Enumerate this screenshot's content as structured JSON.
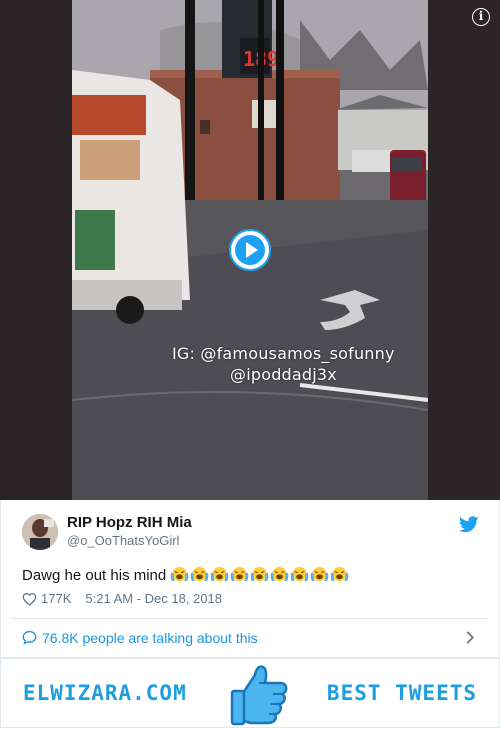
{
  "video": {
    "watermark_line1": "IG: @famousamos_sofunny",
    "watermark_line2": "@ipoddadj3x",
    "price_sign": "189",
    "info_icon": "info-icon",
    "play_icon": "play-icon"
  },
  "tweet": {
    "display_name": "RIP Hopz RIH Mia",
    "handle": "@o_OoThatsYoGirl",
    "text": "Dawg he out his mind",
    "emoji_name": "loudly-crying-face-icon",
    "emoji_count": 9,
    "likes": "177K",
    "timestamp": "5:21 AM - Dec 18, 2018",
    "talking": "76.8K people are talking about this"
  },
  "banner": {
    "left": "ELWIZARA.COM",
    "right": "BEST TWEETS",
    "icon": "thumbs-up-icon"
  },
  "colors": {
    "twitter_blue": "#1da1f2",
    "link_blue": "#1b95e0",
    "brand_blue": "#1e9de0",
    "secondary_text": "#657786"
  }
}
